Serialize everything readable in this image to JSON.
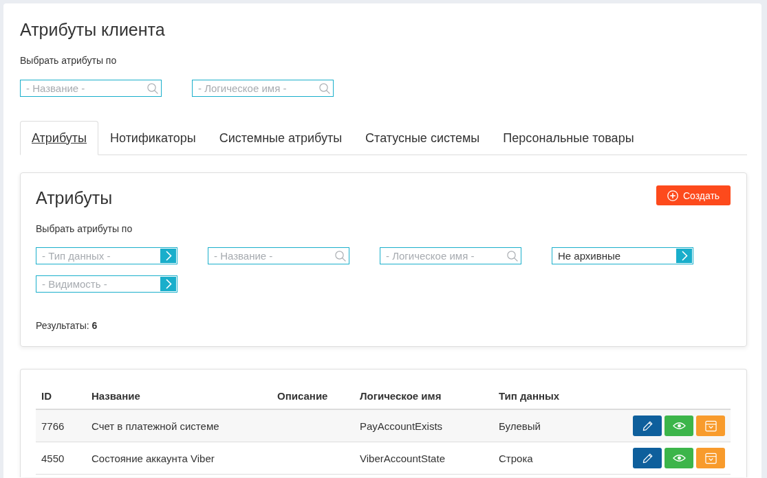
{
  "page": {
    "title": "Атрибуты клиента",
    "filter_label": "Выбрать атрибуты по",
    "filters": [
      {
        "kind": "search",
        "placeholder": "- Название -"
      },
      {
        "kind": "search",
        "placeholder": "- Логическое имя -"
      }
    ]
  },
  "tabs": [
    {
      "label": "Атрибуты",
      "selected": true
    },
    {
      "label": "Нотификаторы",
      "selected": false
    },
    {
      "label": "Системные атрибуты",
      "selected": false
    },
    {
      "label": "Статусные системы",
      "selected": false
    },
    {
      "label": "Персональные товары",
      "selected": false
    }
  ],
  "panel": {
    "title": "Атрибуты",
    "create_button": "Создать",
    "filter_label": "Выбрать атрибуты по",
    "filters": [
      {
        "kind": "select",
        "placeholder": "- Тип данных -"
      },
      {
        "kind": "search",
        "placeholder": "- Название -"
      },
      {
        "kind": "search",
        "placeholder": "- Логическое имя -"
      },
      {
        "kind": "select",
        "value": "Не архивные"
      },
      {
        "kind": "select",
        "placeholder": "- Видимость -"
      }
    ],
    "results": "Результаты: **6**"
  },
  "table": {
    "columns": [
      "ID",
      "Название",
      "Описание",
      "Логическое имя",
      "Тип данных"
    ],
    "rows": [
      {
        "id": "7766",
        "name": "Счет в платежной системе",
        "logical_name": "PayAccountExists",
        "data_type": "Булевый"
      },
      {
        "id": "4550",
        "name": "Состояние аккаунта Viber",
        "logical_name": "ViberAccountState",
        "data_type": "Строка"
      }
    ]
  }
}
